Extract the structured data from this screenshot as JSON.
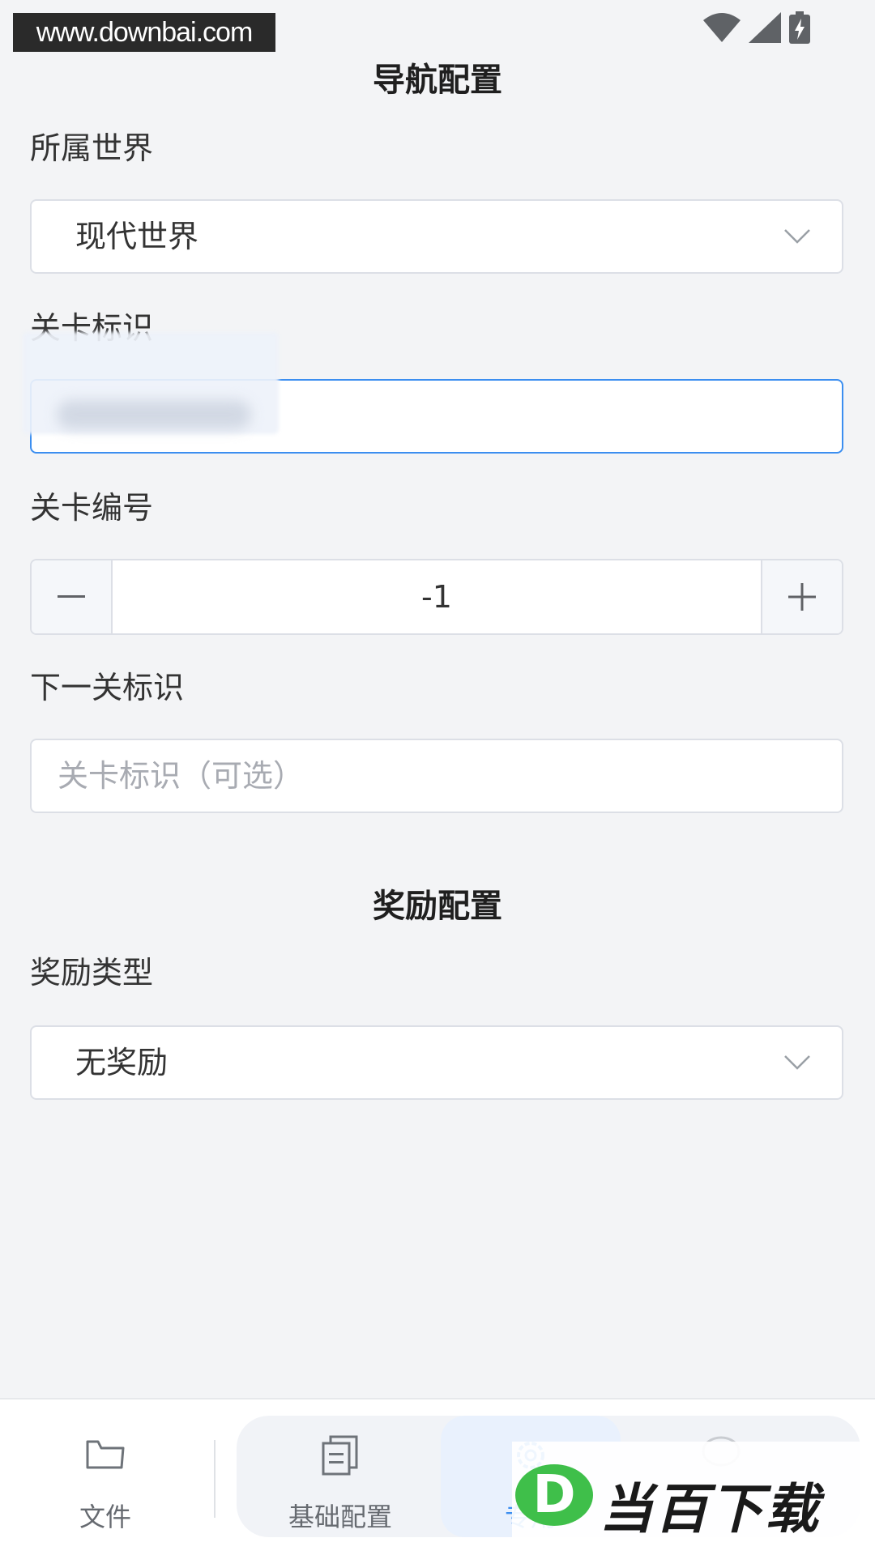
{
  "status_bar": {
    "watermark_url": "www.downbai.com",
    "icons": [
      "wifi-icon",
      "cell-signal-icon",
      "battery-charging-icon"
    ]
  },
  "navigation_section": {
    "title": "导航配置",
    "world": {
      "label": "所属世界",
      "value": "现代世界"
    },
    "level_id": {
      "label": "关卡标识",
      "value": ""
    },
    "level_number": {
      "label": "关卡编号",
      "value": "-1"
    },
    "next_level_id": {
      "label": "下一关标识",
      "placeholder": "关卡标识（可选）"
    }
  },
  "reward_section": {
    "title": "奖励配置",
    "reward_type": {
      "label": "奖励类型",
      "value": "无奖励"
    }
  },
  "bottom_nav": {
    "items": [
      {
        "label": "文件",
        "icon": "folder-icon"
      },
      {
        "label": "基础配置",
        "icon": "copy-document-icon"
      },
      {
        "label": "专用",
        "icon": "gear-icon",
        "active": true
      },
      {
        "label": "",
        "icon": "chat-bubble-icon"
      }
    ]
  },
  "brand_watermark": {
    "text": "当百下载",
    "logo_letter": "D"
  },
  "colors": {
    "accent": "#3b8ef0",
    "background": "#f3f4f6",
    "border": "#dcdfe6"
  }
}
